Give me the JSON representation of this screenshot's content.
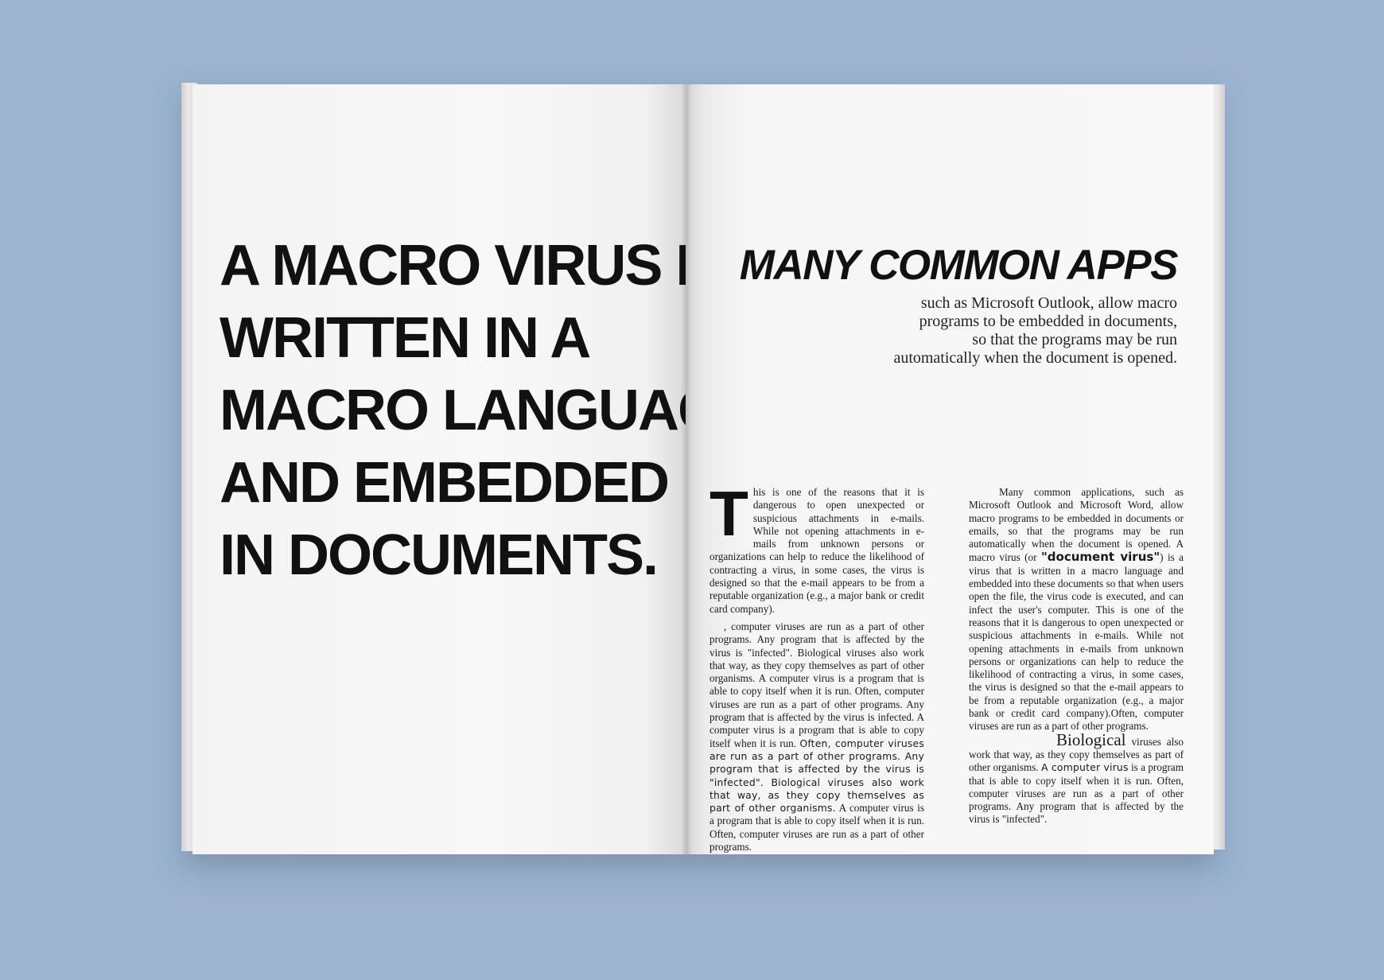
{
  "left_page": {
    "headline_lines": [
      "A MACRO VIRUS IS",
      "WRITTEN IN A",
      "MACRO LANGUAGE",
      "AND EMBEDDED",
      "IN DOCUMENTS."
    ]
  },
  "right_page": {
    "title": "MANY COMMON APPS",
    "subtitle_lines": [
      "such as Microsoft Outlook, allow macro",
      "programs to be embedded in documents,",
      "so that the programs may be run",
      "automatically when the document is opened."
    ],
    "col_a": {
      "dropcap": "T",
      "p1": "his is one of the reasons that it is dangerous to open unexpected or suspicious attachments in e-mails. While not opening attachments in e-mails from unknown persons or organizations can help to reduce the likelihood of contracting a virus, in some cases, the virus is designed so that the e-mail appears to be from a reputable organization (e.g., a major bank or credit card company).",
      "p2": ", computer viruses are run as a part of other programs. Any program that is affected by the virus is \"infected\". Biological viruses also work that way, as they copy themselves as part of other organisms. A computer virus is a program that is able to copy itself when it is run. Often, computer viruses are run as a part of other programs. Any program that is affected by the virus is infected. A computer virus is a program that is able to copy itself when it is run.",
      "p2_wide": "Often, computer viruses are run as a part of other programs. Any program that is affected by the virus is \"infected\". Biological viruses also work that way, as they copy themselves as part of other organisms.",
      "p2_end": "A computer virus is a program that is able to copy itself when it is run. Often, computer viruses are run as a part of other programs."
    },
    "col_b": {
      "p1_before": "Many common applications, such as Microsoft Outlook and Microsoft Word, allow macro programs to be embedded in documents or emails, so that the programs may be run automatically when the document is opened. A macro virus (or",
      "p1_bold": "\"document virus\"",
      "p1_after": ") is a virus that is written in a macro language and embedded into these documents so that when users open the file, the virus code is executed, and can infect the user's computer. This is one of the reasons that it is dangerous to open unexpected or suspicious attachments in e-mails. While not opening attachments in e-mails from unknown persons or organizations can help to reduce the likelihood of contracting a virus, in some cases, the virus is designed so that the e-mail appears to be from a reputable organization (e.g., a major bank or credit card company).Often, computer viruses are run as a part of other programs.",
      "p2_lead": "Biological",
      "p2_a": "viruses also work that way, as they copy themselves as part of other organisms.",
      "p2_b": "A computer virus",
      "p2_c": "is a program that is able to copy itself when it is run. Often, computer viruses are run as a part of other programs. Any program that is affected by the virus is \"infected\"."
    }
  }
}
